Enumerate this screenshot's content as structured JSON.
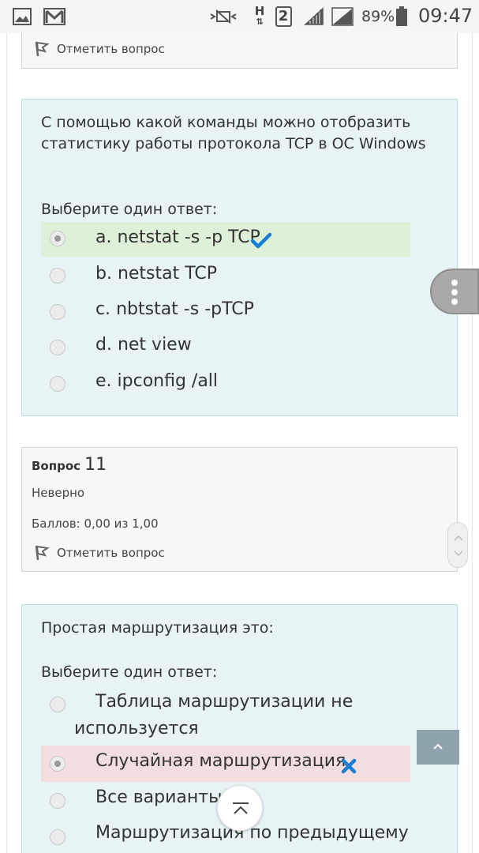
{
  "status_bar": {
    "battery_percent": "89%",
    "time": "09:47",
    "sim_number": "2",
    "network_letter": "H",
    "icons": [
      "image-notification-icon",
      "gmail-icon",
      "mute-icon",
      "h-plus-network-icon",
      "sim-2-icon",
      "signal-icon",
      "signal-icon",
      "battery-icon"
    ]
  },
  "top_partial": {
    "flag_label": "Отметить вопрос"
  },
  "question_10": {
    "text": "С помощью какой команды можно отобразить статистику работы протокола TCP в ОС Windows",
    "prompt": "Выберите один ответ:",
    "options": [
      {
        "label": "a. netstat -s -p TCP",
        "selected": true,
        "state": "correct"
      },
      {
        "label": "b. netstat TCP",
        "selected": false,
        "state": "none"
      },
      {
        "label": "c. nbtstat -s -pTCP",
        "selected": false,
        "state": "none"
      },
      {
        "label": "d. net view",
        "selected": false,
        "state": "none"
      },
      {
        "label": "e. ipconfig /all",
        "selected": false,
        "state": "none"
      }
    ]
  },
  "question_11_info": {
    "label": "Вопрос",
    "number": "11",
    "status": "Неверно",
    "score": "Баллов: 0,00 из 1,00",
    "flag_label": "Отметить вопрос"
  },
  "question_11": {
    "text": "Простая маршрутизация это:",
    "prompt": "Выберите один ответ:",
    "options": [
      {
        "label": "Таблица маршрутизации не используется",
        "selected": false,
        "state": "none"
      },
      {
        "label": "Случайная маршрутизация",
        "selected": true,
        "state": "incorrect"
      },
      {
        "label": "Все варианты",
        "selected": false,
        "state": "none"
      },
      {
        "label": "Маршрутизация по предыдущему",
        "selected": false,
        "state": "none"
      }
    ]
  },
  "colors": {
    "question_bg": "#e7f3f5",
    "info_bg": "#f7f7f7",
    "correct_bg": "#dff0d8",
    "incorrect_bg": "#f2dede",
    "check_color": "#1a7fd4",
    "cross_color": "#1a7fd4"
  }
}
